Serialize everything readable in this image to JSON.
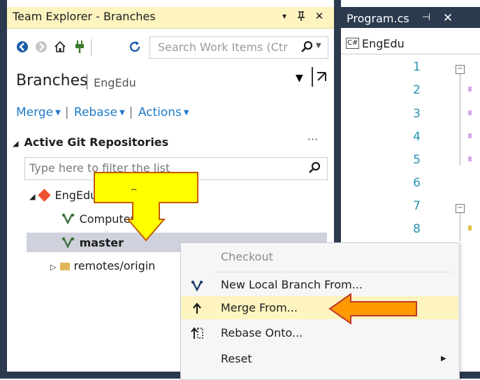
{
  "team_explorer": {
    "title": "Team Explorer - Branches",
    "titlebar_dropdown": "▾",
    "titlebar_pin": "ꟷ",
    "titlebar_close": "✕",
    "search_placeholder": "Search Work Items (Ctr",
    "page_title": "Branches",
    "repo_name": "EngEdu",
    "nav": {
      "merge": "Merge",
      "rebase": "Rebase",
      "actions": "Actions"
    },
    "repos_header": "Active Git Repositories",
    "repos_more": "···",
    "filter_placeholder": "Type here to filter the list",
    "tree": {
      "repo": "EngEdu",
      "branches": [
        "ComputerLab",
        "master"
      ],
      "remotes": "remotes/origin"
    }
  },
  "editor": {
    "tab_label": "Program.cs",
    "tab_pin": "⊣",
    "tab_close": "✕",
    "navbar_badge": "C#",
    "navbar_label": "EngEdu",
    "line_numbers": [
      "1",
      "2",
      "3",
      "4",
      "5",
      "6",
      "7",
      "8"
    ]
  },
  "context_menu": {
    "items": [
      {
        "label": "Checkout",
        "enabled": false,
        "icon": ""
      },
      {
        "label": "New Local Branch From...",
        "enabled": true,
        "icon": "branch-icon"
      },
      {
        "label": "Merge From...",
        "enabled": true,
        "icon": "merge-icon",
        "highlighted": true
      },
      {
        "label": "Rebase Onto...",
        "enabled": true,
        "icon": "rebase-icon"
      },
      {
        "label": "Reset",
        "enabled": true,
        "icon": "",
        "has_submenu": true
      }
    ]
  },
  "annotations": {
    "yellow_arrow_text": "⌢"
  },
  "colors": {
    "titlebar": "#fdf4bf",
    "frame": "#2b3a4e",
    "link": "#1e7acb",
    "selection": "#cfd2dc",
    "yellow_arrow": "#ffff00",
    "orange_arrow": "#ff9900",
    "git_logo": "#f05133"
  }
}
